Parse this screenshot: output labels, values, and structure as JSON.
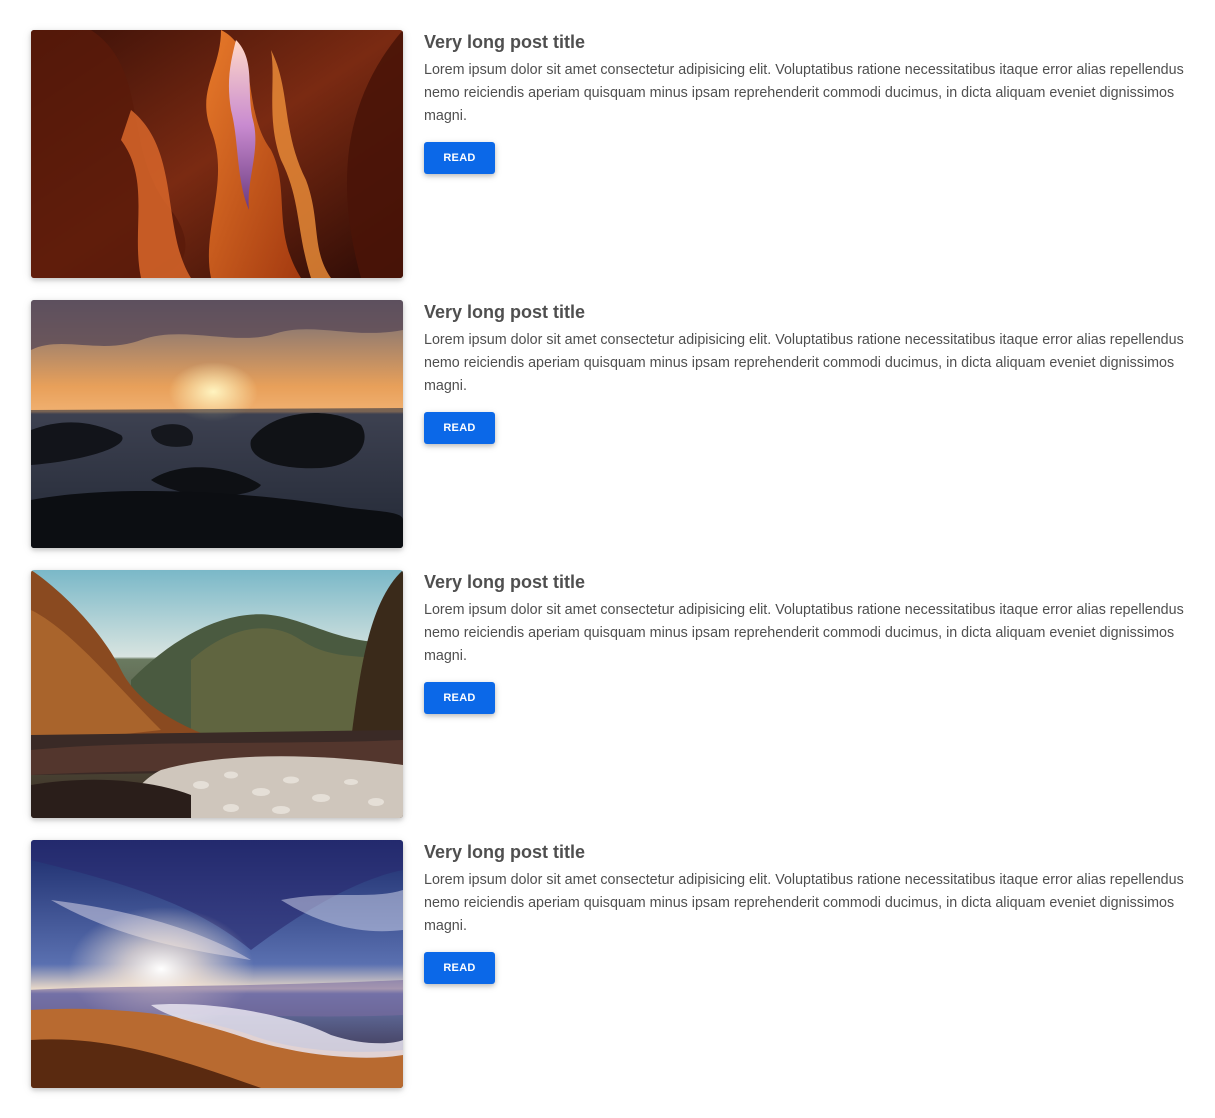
{
  "posts": [
    {
      "title": "Very long post title",
      "excerpt": "Lorem ipsum dolor sit amet consectetur adipisicing elit. Voluptatibus ratione necessitatibus itaque error alias repellendus nemo reiciendis aperiam quisquam minus ipsam reprehenderit commodi ducimus, in dicta aliquam eveniet dignissimos magni.",
      "button_label": "Read",
      "image": "canyon-photo"
    },
    {
      "title": "Very long post title",
      "excerpt": "Lorem ipsum dolor sit amet consectetur adipisicing elit. Voluptatibus ratione necessitatibus itaque error alias repellendus nemo reiciendis aperiam quisquam minus ipsam reprehenderit commodi ducimus, in dicta aliquam eveniet dignissimos magni.",
      "button_label": "Read",
      "image": "sunset-sea-rocks-photo"
    },
    {
      "title": "Very long post title",
      "excerpt": "Lorem ipsum dolor sit amet consectetur adipisicing elit. Voluptatibus ratione necessitatibus itaque error alias repellendus nemo reiciendis aperiam quisquam minus ipsam reprehenderit commodi ducimus, in dicta aliquam eveniet dignissimos magni.",
      "button_label": "Read",
      "image": "autumn-forest-river-photo"
    },
    {
      "title": "Very long post title",
      "excerpt": "Lorem ipsum dolor sit amet consectetur adipisicing elit. Voluptatibus ratione necessitatibus itaque error alias repellendus nemo reiciendis aperiam quisquam minus ipsam reprehenderit commodi ducimus, in dicta aliquam eveniet dignissimos magni.",
      "button_label": "Read",
      "image": "beach-sunrise-photo"
    }
  ],
  "colors": {
    "button": "#0b68e8",
    "text": "#4f4f4f"
  }
}
